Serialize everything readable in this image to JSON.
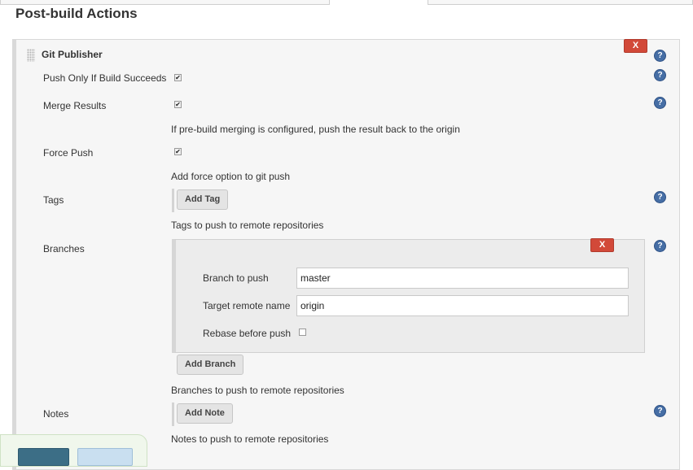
{
  "section": {
    "title": "Post-build Actions"
  },
  "publisher": {
    "title": "Git Publisher",
    "delete_label": "X",
    "help_label": "?"
  },
  "fields": {
    "push_only": {
      "label": "Push Only If Build Succeeds",
      "checked": true
    },
    "merge_results": {
      "label": "Merge Results",
      "checked": true,
      "description": "If pre-build merging is configured, push the result back to the origin"
    },
    "force_push": {
      "label": "Force Push",
      "checked": true,
      "description": "Add force option to git push"
    },
    "tags": {
      "label": "Tags",
      "button": "Add Tag",
      "description": "Tags to push to remote repositories"
    },
    "branches": {
      "label": "Branches",
      "button": "Add Branch",
      "description": "Branches to push to remote repositories",
      "entry": {
        "delete_label": "X",
        "branch_to_push_label": "Branch to push",
        "branch_to_push_value": "master",
        "target_remote_label": "Target remote name",
        "target_remote_value": "origin",
        "rebase_label": "Rebase before push",
        "rebase_checked": false
      }
    },
    "notes": {
      "label": "Notes",
      "button": "Add Note",
      "description": "Notes to push to remote repositories"
    }
  },
  "colors": {
    "delete_red": "#d24939",
    "help_blue": "#466ea5",
    "save_blue": "#3c6e86"
  },
  "check_glyph": "✔"
}
